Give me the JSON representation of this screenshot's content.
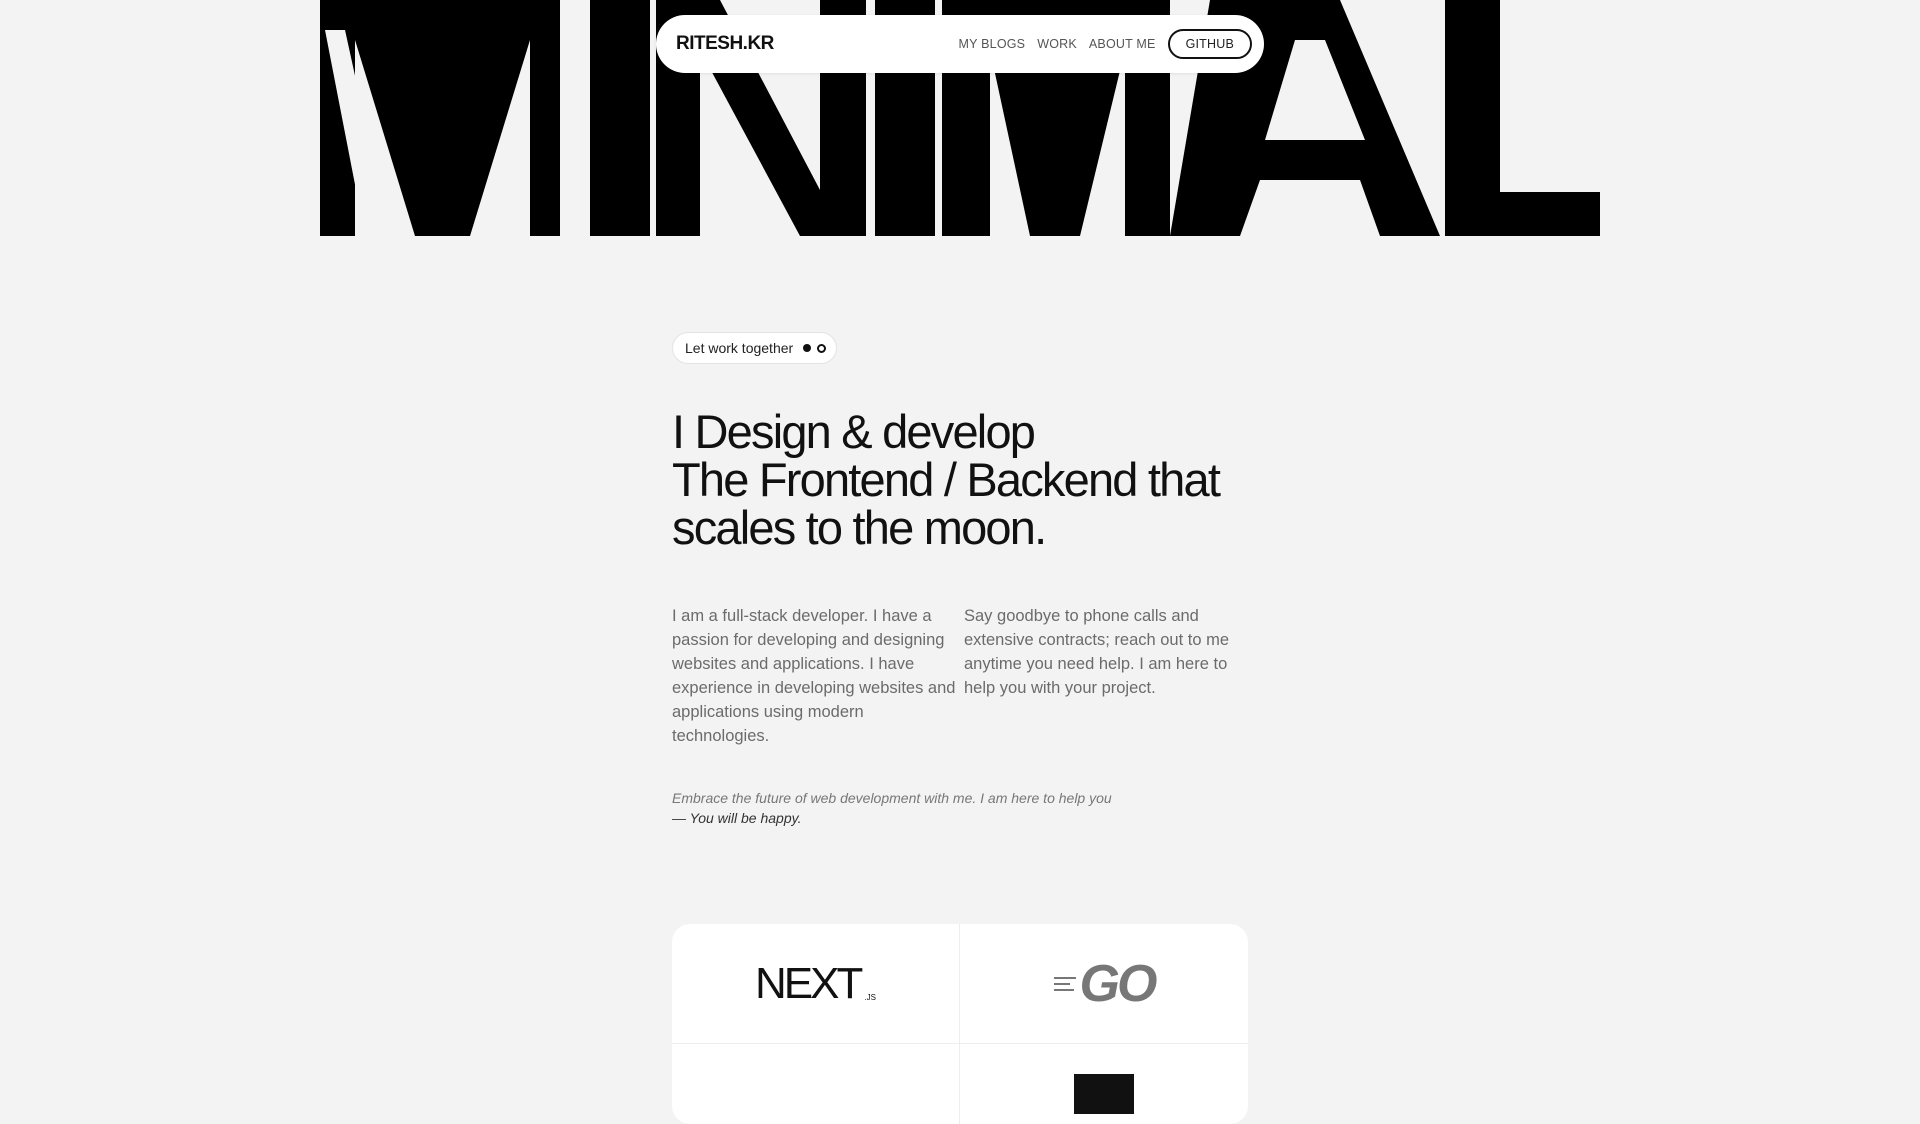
{
  "hero": {
    "word": "MINIMAL"
  },
  "navbar": {
    "brand": "RITESH.KR",
    "links": [
      "MY BLOGS",
      "WORK",
      "ABOUT ME"
    ],
    "github_label": "GITHUB"
  },
  "pill": {
    "label": "Let work together"
  },
  "headline": {
    "lines": [
      "I Design & develop",
      "The Frontend / Backend that",
      "scales to the moon."
    ]
  },
  "paragraphs": {
    "left": "I am a full-stack developer. I have a passion for developing and designing websites and applications. I have experience in developing websites and applications using modern technologies.",
    "right": "Say goodbye to phone calls and extensive contracts; reach out to me anytime you need help. I am here to help you with your project."
  },
  "quote": {
    "text": "Embrace the future of web development with me. I am here to help you",
    "signature": "— You will be happy."
  },
  "tech": {
    "items": [
      {
        "name": "NEXT",
        "suffix": ".JS",
        "icon": "nextjs-logo"
      },
      {
        "name": "GO",
        "icon": "go-logo"
      }
    ]
  }
}
